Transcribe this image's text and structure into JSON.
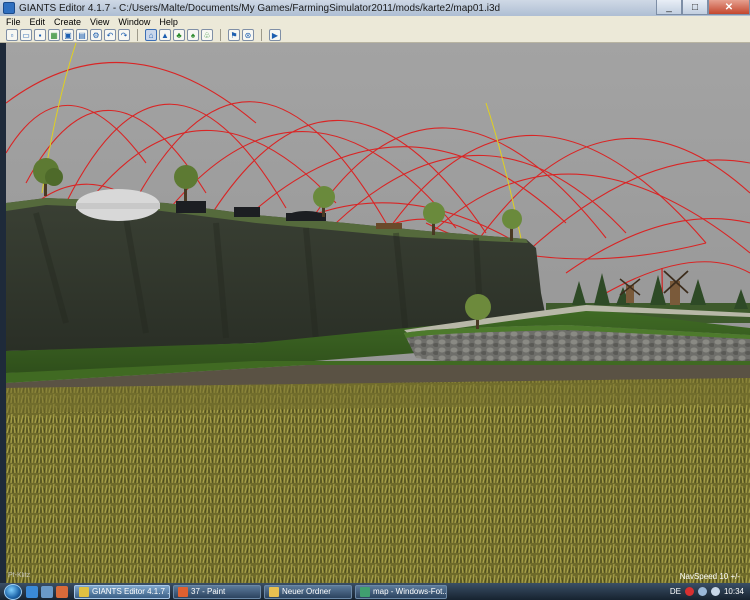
{
  "window": {
    "title": "GIANTS Editor 4.1.7 - C:/Users/Malte/Documents/My Games/FarmingSimulator2011/mods/karte2/map01.i3d",
    "minimize": "_",
    "maximize": "□",
    "close": "✕"
  },
  "menu": [
    "File",
    "Edit",
    "Create",
    "View",
    "Window",
    "Help"
  ],
  "toolbar": {
    "icons": [
      "new-icon",
      "open-icon",
      "save-icon",
      "save-all-icon",
      "import-icon",
      "export-icon",
      "settings-icon",
      "undo-icon",
      "redo-icon",
      "select-tool-icon",
      "terrain-paint-icon",
      "foliage-paint-icon",
      "grass-paint-icon",
      "tree-paint-icon",
      "script-icon",
      "debug-icon",
      "play-icon"
    ]
  },
  "viewport": {
    "nav_speed": "NavSpeed 10 +/-",
    "watermark": "Pf-Klitz"
  },
  "taskbar": {
    "tasks": [
      {
        "label": "GIANTS Editor 4.1.7 ...",
        "active": true,
        "color": "#e0c040"
      },
      {
        "label": "37 - Paint",
        "active": false,
        "color": "#e06030"
      },
      {
        "label": "Neuer Ordner",
        "active": false,
        "color": "#e8c050"
      },
      {
        "label": "map - Windows-Fot...",
        "active": false,
        "color": "#40a070"
      }
    ],
    "language": "DE",
    "clock": "10:34"
  }
}
